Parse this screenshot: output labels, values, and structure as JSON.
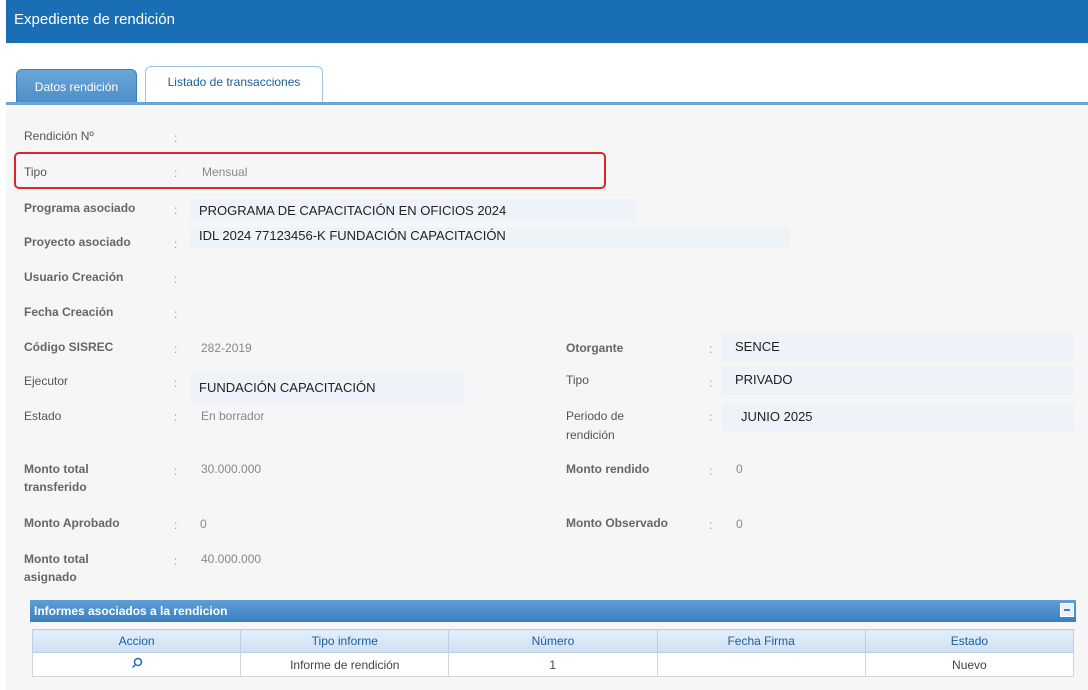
{
  "window": {
    "title": "Expediente de rendición"
  },
  "tabs": [
    {
      "label": "Datos rendición"
    },
    {
      "label": "Listado de transacciones"
    }
  ],
  "fields": {
    "rendicion_n": {
      "label": "Rendición Nº",
      "value": ""
    },
    "tipo": {
      "label": "Tipo",
      "value": "Mensual"
    },
    "programa": {
      "label": "Programa asociado",
      "value": "PROGRAMA DE CAPACITACIÓN EN OFICIOS 2024"
    },
    "proyecto": {
      "label": "Proyecto asociado",
      "value": "IDL 2024 77123456-K FUNDACIÓN CAPACITACIÓN"
    },
    "usuario_creacion": {
      "label": "Usuario Creación",
      "value": ""
    },
    "fecha_creacion": {
      "label": "Fecha Creación",
      "value": ""
    },
    "codigo_sisrec": {
      "label": "Código SISREC",
      "value": "282-2019"
    },
    "ejecutor": {
      "label": "Ejecutor",
      "value": "FUNDACIÓN CAPACITACIÓN"
    },
    "estado": {
      "label": "Estado",
      "value": "En borrador"
    },
    "monto_transferido": {
      "label_l1": "Monto total",
      "label_l2": "transferido",
      "value": "30.000.000"
    },
    "monto_aprobado": {
      "label": "Monto Aprobado",
      "value": "0"
    },
    "monto_asignado": {
      "label_l1": "Monto total",
      "label_l2": "asignado",
      "value": "40.000.000"
    },
    "otorgante": {
      "label": "Otorgante",
      "value": "SENCE"
    },
    "tipo2": {
      "label": "Tipo",
      "value": "PRIVADO"
    },
    "periodo": {
      "label_l1": "Periodo de",
      "label_l2": "rendición",
      "value": "JUNIO 2025"
    },
    "monto_rendido": {
      "label": "Monto rendido",
      "value": "0"
    },
    "monto_observado": {
      "label": "Monto Observado",
      "value": "0"
    }
  },
  "colon": ":",
  "informes": {
    "title": "Informes asociados a la rendicion",
    "columns": [
      "Accion",
      "Tipo informe",
      "Número",
      "Fecha Firma",
      "Estado"
    ],
    "rows": [
      {
        "accion_icon": "search-icon",
        "tipo": "Informe de rendición",
        "numero": "1",
        "fecha_firma": "",
        "estado": "Nuevo"
      }
    ]
  },
  "colors": {
    "header_blue": "#1a6fb4",
    "highlight_red": "#d9262b"
  }
}
